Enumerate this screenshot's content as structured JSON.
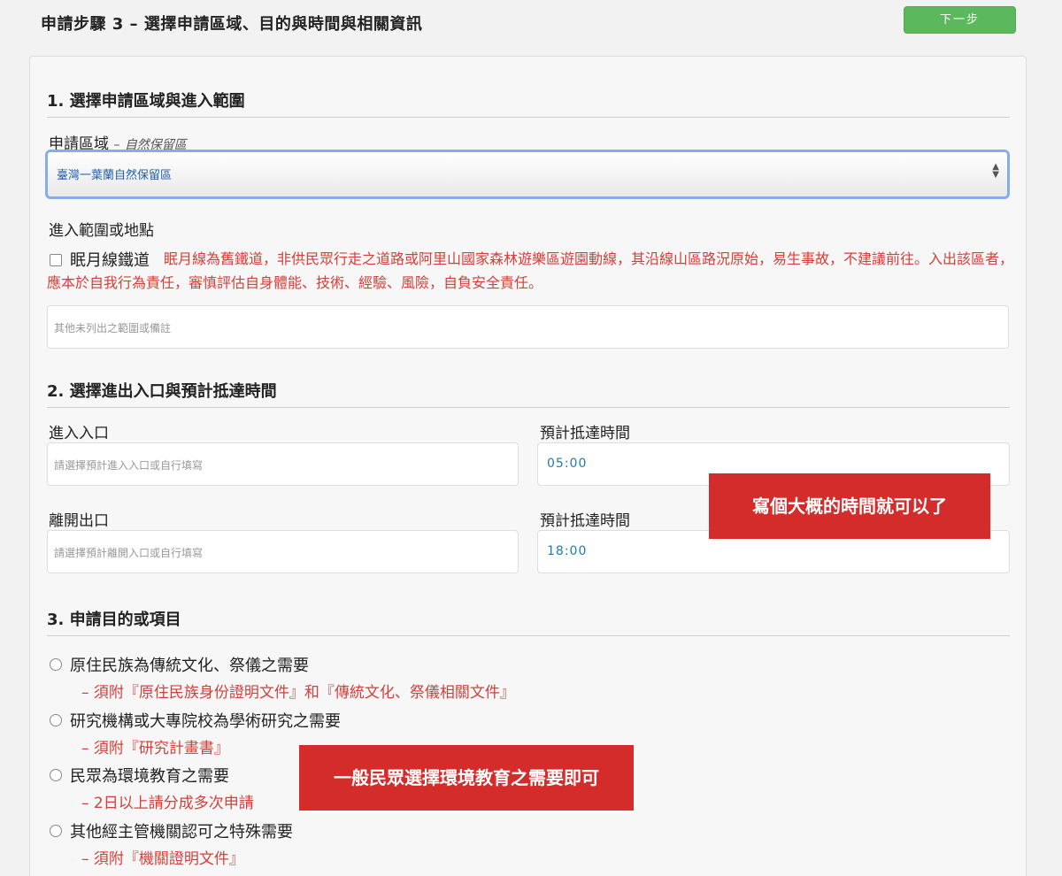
{
  "header": {
    "step_title": "申請步驟 3 – 選擇申請區域、目的與時間與相關資訊",
    "next_label": "下一步"
  },
  "section1": {
    "heading": "1. 選擇申請區域與進入範圍",
    "area_label": "申請區域",
    "area_dash": "–",
    "area_sub": "自然保留區",
    "area_selected": "臺灣一葉蘭自然保留區",
    "range_label": "進入範圍或地點",
    "rail_checkbox_label": "眠月線鐵道",
    "rail_warning": "眠月線為舊鐵道，非供民眾行走之道路或阿里山國家森林遊樂區遊園動線，其沿線山區路況原始，易生事故，不建議前往。入出該區者，應本於自我行為責任，審慎評估自身體能、技術、經驗、風險，自負安全責任。",
    "other_placeholder": "其他未列出之範圍或備註"
  },
  "section2": {
    "heading": "2. 選擇進出入口與預計抵達時間",
    "entry_label": "進入入口",
    "entry_placeholder": "請選擇預計進入入口或自行填寫",
    "entry_time_label": "預計抵達時間",
    "entry_time": "05:00",
    "exit_label": "離開出口",
    "exit_placeholder": "請選擇預計離開入口或自行填寫",
    "exit_time_label": "預計抵達時間",
    "exit_time": "18:00"
  },
  "section3": {
    "heading": "3. 申請目的或項目",
    "options": [
      {
        "label": "原住民族為傳統文化、祭儀之需要",
        "note": "– 須附『原住民族身份證明文件』和『傳統文化、祭儀相關文件』"
      },
      {
        "label": "研究機構或大專院校為學術研究之需要",
        "note": "– 須附『研究計畫書』"
      },
      {
        "label": "民眾為環境教育之需要",
        "note": "– 2日以上請分成多次申請"
      },
      {
        "label": "其他經主管機關認可之特殊需要",
        "note": "– 須附『機關證明文件』"
      }
    ]
  },
  "callouts": {
    "time_hint": "寫個大概的時間就可以了",
    "purpose_hint": "一般民眾選擇環境教育之需要即可"
  },
  "colors": {
    "accent_green": "#5cb85c",
    "warning_red": "#d43f3a",
    "callout_red": "#d42b2b",
    "select_focus_border": "#86aee6"
  }
}
